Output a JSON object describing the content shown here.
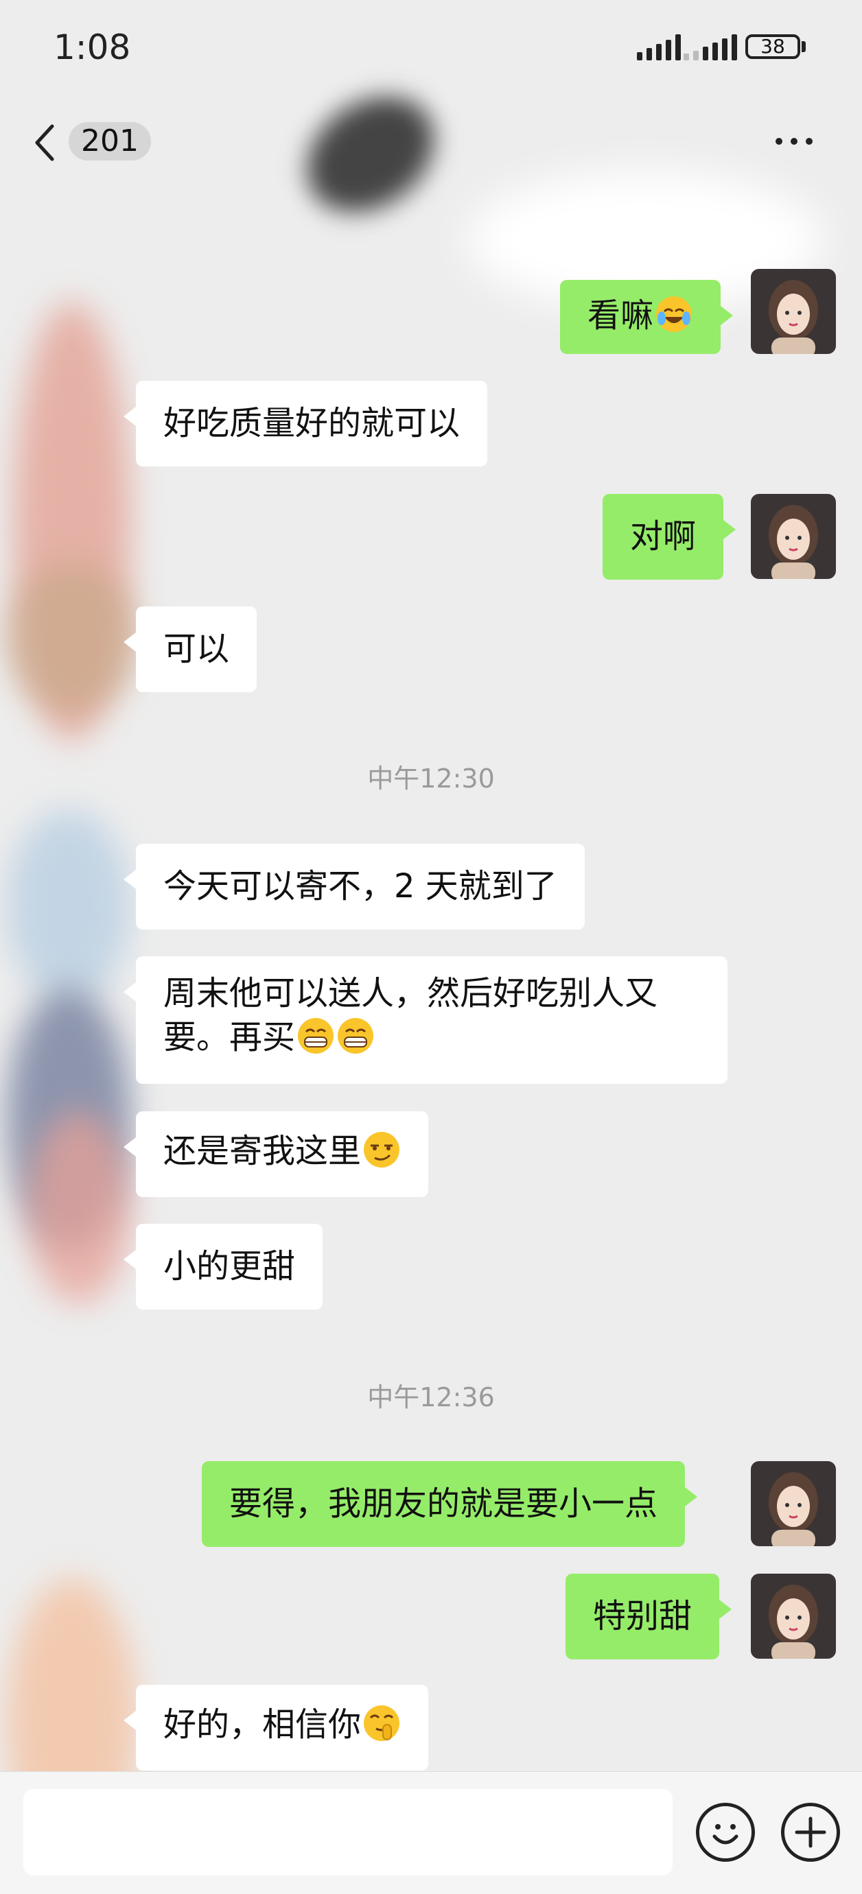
{
  "status_bar": {
    "time": "1:08",
    "battery": "38"
  },
  "nav": {
    "badge": "201"
  },
  "timestamps": [
    "中午12:30",
    "中午12:36"
  ],
  "messages": [
    {
      "side": "right",
      "text": "看嘛"
    },
    {
      "side": "left",
      "text": "好吃质量好的就可以"
    },
    {
      "side": "right",
      "text": "对啊"
    },
    {
      "side": "left",
      "text": "可以"
    },
    {
      "side": "left",
      "text": "今天可以寄不，2 天就到了"
    },
    {
      "side": "left",
      "line1": "周末他可以送人，然后好吃别人又",
      "line2": "要。再买"
    },
    {
      "side": "left",
      "text": "还是寄我这里"
    },
    {
      "side": "left",
      "text": "小的更甜"
    },
    {
      "side": "right",
      "text": "要得，我朋友的就是要小一点"
    },
    {
      "side": "right",
      "text": "特别甜"
    },
    {
      "side": "left",
      "text": "好的，相信你"
    }
  ],
  "icons": {
    "back": "chevron-left-icon",
    "more": "more-dots-icon",
    "emoji_button": "smiley-icon",
    "plus_button": "plus-circle-icon"
  },
  "colors": {
    "sent_bubble": "#95ec69",
    "received_bubble": "#ffffff",
    "background": "#ededed"
  }
}
